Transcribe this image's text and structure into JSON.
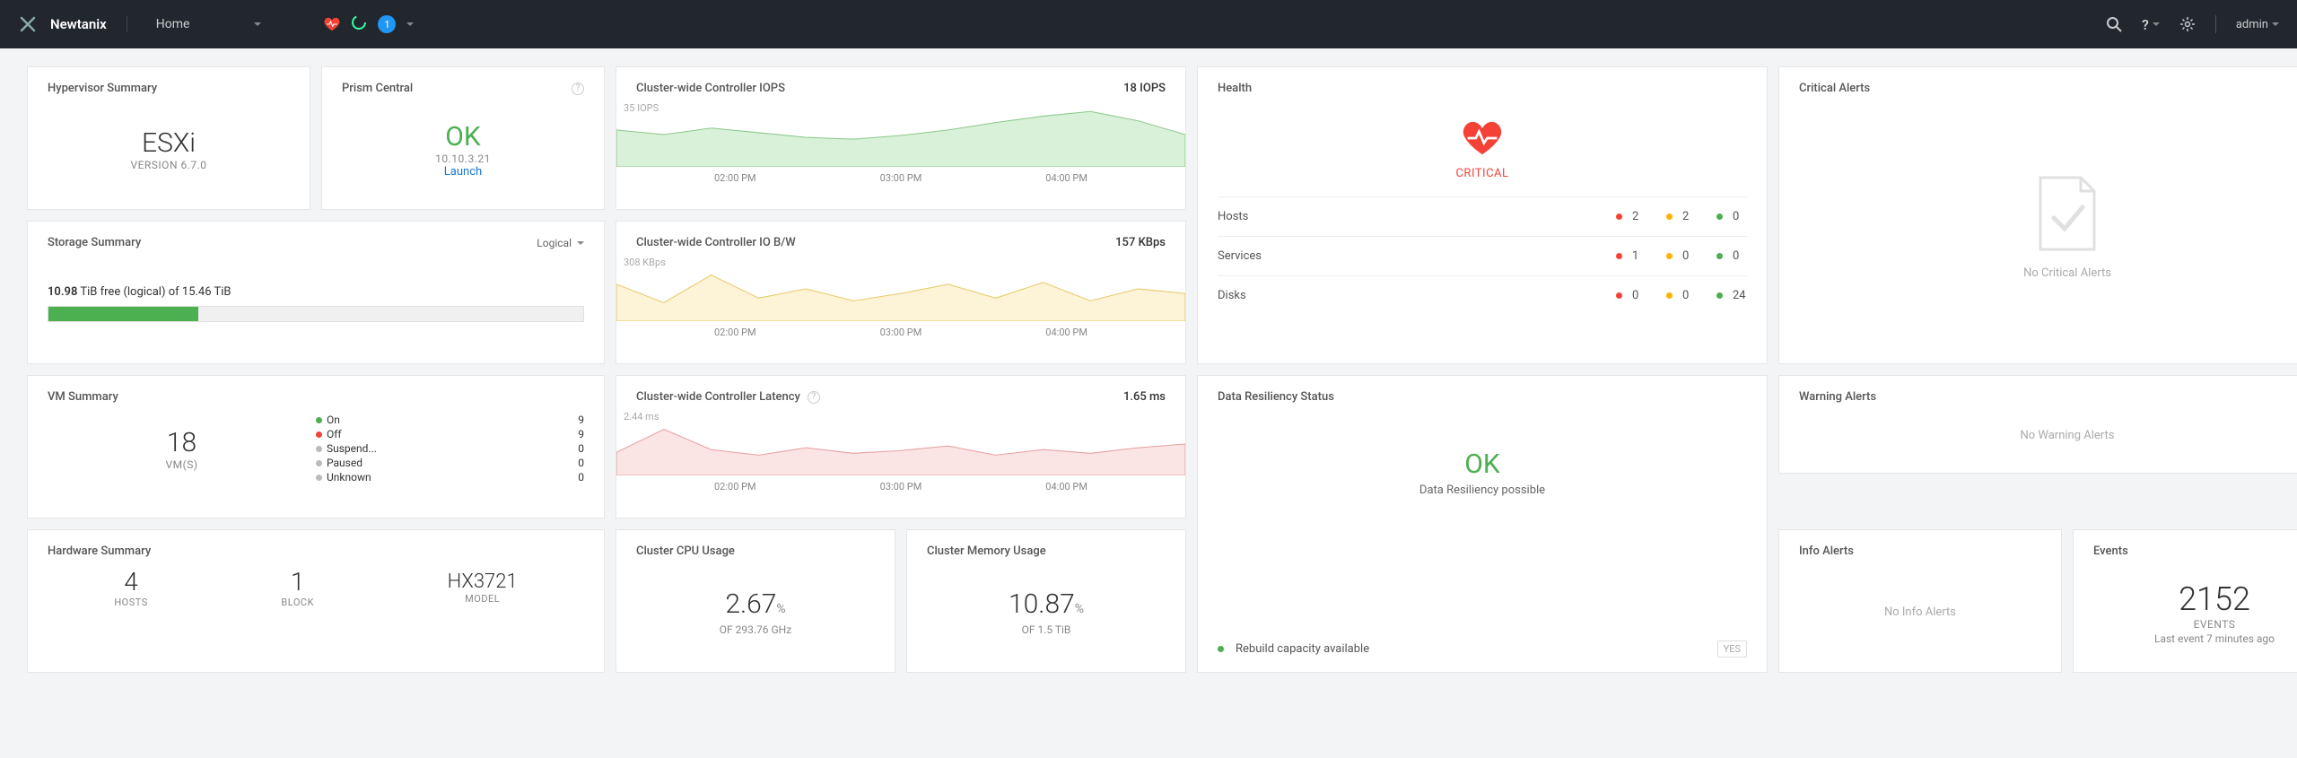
{
  "topbar": {
    "brand": "Newtanix",
    "nav_label": "Home",
    "badge_count": "1",
    "search_icon": "search",
    "help_icon": "?",
    "gear_icon": "settings",
    "user_label": "admin"
  },
  "hypervisor": {
    "title": "Hypervisor Summary",
    "value": "ESXi",
    "sub": "VERSION 6.7.0"
  },
  "prism": {
    "title": "Prism Central",
    "status": "OK",
    "ip": "10.10.3.21",
    "launch": "Launch"
  },
  "charts": {
    "iops": {
      "title": "Cluster-wide Controller IOPS",
      "value": "18 IOPS",
      "yaxis": "35 IOPS",
      "ticks": [
        "02:00 PM",
        "03:00 PM",
        "04:00 PM"
      ]
    },
    "iobw": {
      "title": "Cluster-wide Controller IO B/W",
      "value": "157 KBps",
      "yaxis": "308 KBps",
      "ticks": [
        "02:00 PM",
        "03:00 PM",
        "04:00 PM"
      ]
    },
    "latency": {
      "title": "Cluster-wide Controller Latency",
      "value": "1.65 ms",
      "yaxis": "2.44 ms",
      "ticks": [
        "02:00 PM",
        "03:00 PM",
        "04:00 PM"
      ]
    }
  },
  "storage": {
    "title": "Storage Summary",
    "toggle": "Logical",
    "free_value": "10.98",
    "free_unit": "TiB free (logical) of",
    "total": "15.46 TiB"
  },
  "vm": {
    "title": "VM Summary",
    "count": "18",
    "unit": "VM(S)",
    "states": [
      {
        "label": "On",
        "count": "9",
        "dot": "green"
      },
      {
        "label": "Off",
        "count": "9",
        "dot": "red"
      },
      {
        "label": "Suspend...",
        "count": "0",
        "dot": "grey"
      },
      {
        "label": "Paused",
        "count": "0",
        "dot": "grey"
      },
      {
        "label": "Unknown",
        "count": "0",
        "dot": "grey"
      }
    ]
  },
  "hardware": {
    "title": "Hardware Summary",
    "hosts": "4",
    "hosts_label": "HOSTS",
    "blocks": "1",
    "blocks_label": "BLOCK",
    "model": "HX3721",
    "model_label": "MODEL"
  },
  "cpu": {
    "title": "Cluster CPU Usage",
    "value": "2.67",
    "pct": "%",
    "sub": "OF 293.76 GHz"
  },
  "mem": {
    "title": "Cluster Memory Usage",
    "value": "10.87",
    "pct": "%",
    "sub": "OF 1.5 TiB"
  },
  "health": {
    "title": "Health",
    "status": "CRITICAL",
    "rows": [
      {
        "label": "Hosts",
        "red": "2",
        "yellow": "2",
        "green": "0"
      },
      {
        "label": "Services",
        "red": "1",
        "yellow": "0",
        "green": "0"
      },
      {
        "label": "Disks",
        "red": "0",
        "yellow": "0",
        "green": "24"
      }
    ]
  },
  "resiliency": {
    "title": "Data Resiliency Status",
    "status": "OK",
    "sub": "Data Resiliency possible",
    "footer_label": "Rebuild capacity available",
    "footer_val": "YES"
  },
  "crit_alerts": {
    "title": "Critical Alerts",
    "empty": "No Critical Alerts"
  },
  "warn_alerts": {
    "title": "Warning Alerts",
    "empty": "No Warning Alerts"
  },
  "info_alerts": {
    "title": "Info Alerts",
    "empty": "No Info Alerts"
  },
  "events": {
    "title": "Events",
    "count": "2152",
    "label": "EVENTS",
    "sub": "Last event 7 minutes ago"
  },
  "chart_data": [
    {
      "type": "line",
      "title": "Cluster-wide Controller IOPS",
      "ylabel": "IOPS",
      "ylim": [
        0,
        35
      ],
      "x": [
        "02:00 PM",
        "03:00 PM",
        "04:00 PM"
      ],
      "series": [
        {
          "name": "IOPS",
          "values": [
            20,
            18,
            22,
            19,
            17,
            16,
            18,
            21,
            25,
            28,
            30,
            26,
            18
          ]
        }
      ]
    },
    {
      "type": "line",
      "title": "Cluster-wide Controller IO B/W",
      "ylabel": "KBps",
      "ylim": [
        0,
        308
      ],
      "x": [
        "02:00 PM",
        "03:00 PM",
        "04:00 PM"
      ],
      "series": [
        {
          "name": "IO B/W",
          "values": [
            180,
            120,
            220,
            150,
            170,
            140,
            160,
            180,
            150,
            190,
            140,
            170,
            157
          ]
        }
      ]
    },
    {
      "type": "line",
      "title": "Cluster-wide Controller Latency",
      "ylabel": "ms",
      "ylim": [
        0,
        2.44
      ],
      "x": [
        "02:00 PM",
        "03:00 PM",
        "04:00 PM"
      ],
      "series": [
        {
          "name": "Latency",
          "values": [
            1.2,
            2.0,
            1.3,
            1.1,
            1.4,
            1.2,
            1.3,
            1.5,
            1.1,
            1.3,
            1.2,
            1.4,
            1.65
          ]
        }
      ]
    }
  ]
}
